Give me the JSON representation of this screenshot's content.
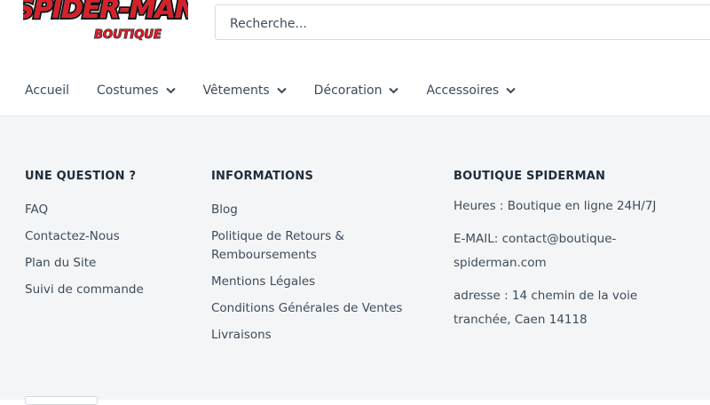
{
  "logo": {
    "title": "SPIDER-MAN",
    "subtitle": "BOUTIQUE"
  },
  "search": {
    "placeholder": "Recherche..."
  },
  "nav": {
    "items": [
      {
        "label": "Accueil",
        "has_dropdown": false
      },
      {
        "label": "Costumes",
        "has_dropdown": true
      },
      {
        "label": "Vêtements",
        "has_dropdown": true
      },
      {
        "label": "Décoration",
        "has_dropdown": true
      },
      {
        "label": "Accessoires",
        "has_dropdown": true
      }
    ]
  },
  "footer": {
    "question": {
      "title": "UNE QUESTION ?",
      "links": [
        "FAQ",
        "Contactez-Nous",
        "Plan du Site",
        "Suivi de commande"
      ]
    },
    "informations": {
      "title": "INFORMATIONS",
      "links": [
        "Blog",
        "Politique de Retours &",
        "Remboursements",
        "Mentions Légales",
        "Conditions Générales de Ventes",
        "Livraisons"
      ]
    },
    "boutique": {
      "title": "BOUTIQUE SPIDERMAN",
      "hours": "Heures : Boutique en ligne 24H/7J",
      "email_line1": "E-MAIL: contact@boutique-",
      "email_line2": "spiderman.com",
      "address_line1": "adresse : 14 chemin de la voie",
      "address_line2": "tranchée, Caen 14118"
    }
  },
  "colors": {
    "brand_red": "#d8202a",
    "footer_bg": "#f3f5f6",
    "text": "#3d4c5b",
    "heading": "#1e2d3d"
  }
}
